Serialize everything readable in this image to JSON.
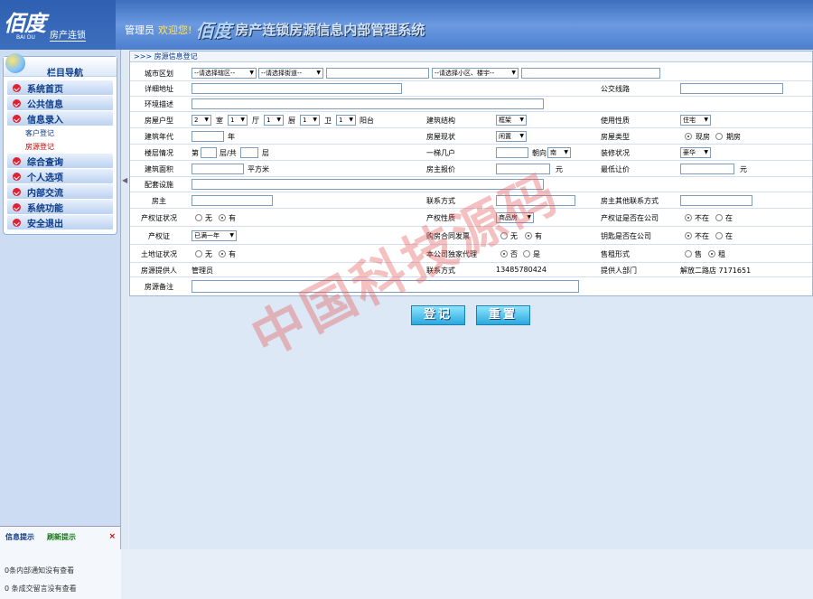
{
  "header": {
    "logo_main": "佰度",
    "logo_sub": "BAI DU",
    "logo_tag": "房产连锁",
    "user": "管理员",
    "welcome": "欢迎您!",
    "brand": "佰度",
    "title": "房产连锁房源信息内部管理系统"
  },
  "sidebar": {
    "title": "栏目导航",
    "items": [
      "系统首页",
      "公共信息",
      "信息录入",
      "综合查询",
      "个人选项",
      "内部交流",
      "系统功能",
      "安全退出"
    ],
    "subitems": [
      "客户登记",
      "房源登记"
    ]
  },
  "tips": {
    "tab_info": "信息提示",
    "tab_refresh": "刷新提示",
    "close": "×",
    "line1": "0条内部通知没有查看",
    "line2": "0 条成交留言没有查看"
  },
  "form": {
    "heading": ">>> 房源信息登记",
    "labels": {
      "city_district": "城市区划",
      "address": "详细地址",
      "bus_route": "公交线路",
      "environment": "环境描述",
      "house_type": "房屋户型",
      "room": "室",
      "hall": "厅",
      "kitchen": "厨",
      "bath": "卫",
      "balcony": "阳台",
      "structure": "建筑结构",
      "usage": "使用性质",
      "build_year": "建筑年代",
      "year_unit": "年",
      "condition": "房屋现状",
      "house_category": "房屋类型",
      "floor": "楼层情况",
      "floor_prefix": "第",
      "floor_mid": "层/共",
      "floor_suffix": "层",
      "households": "一梯几户",
      "orientation": "朝向",
      "decoration": "装修状况",
      "area": "建筑面积",
      "area_unit": "平方米",
      "owner_price": "房主报价",
      "price_unit": "元",
      "min_price": "最低让价",
      "min_unit": "元",
      "facilities": "配套设施",
      "owner": "房主",
      "contact": "联系方式",
      "owner_other_contact": "房主其他联系方式",
      "title_deed": "产权证状况",
      "property_nature": "产权性质",
      "deed_in_company": "产权证是否在公司",
      "deed": "产权证",
      "purchase_invoice": "购房合同发票",
      "keys_in_company": "钥匙是否在公司",
      "land_cert": "土地证状况",
      "exclusive_agent": "本公司独家代理",
      "sale_mode": "售租形式",
      "provider": "房源提供人",
      "provider_contact": "联系方式",
      "provider_dept": "提供人部门",
      "remark": "房源备注"
    },
    "selects": {
      "district": "--请选择辖区--",
      "street": "--请选择街道--",
      "community": "--请选择小区、楼宇--",
      "rooms": "2",
      "halls": "1",
      "kitchens": "1",
      "baths": "1",
      "balconies": "1",
      "structure": "框架",
      "usage": "住宅",
      "condition": "闲置",
      "orientation": "南",
      "decoration": "豪华",
      "property_nature": "商品房",
      "deed": "已满一年"
    },
    "radios": {
      "house_category": [
        "现房",
        "期房"
      ],
      "title_deed": [
        "无",
        "有"
      ],
      "deed_in_company": [
        "不在",
        "在"
      ],
      "purchase_invoice": [
        "无",
        "有"
      ],
      "keys_in_company": [
        "不在",
        "在"
      ],
      "land_cert": [
        "无",
        "有"
      ],
      "exclusive_agent": [
        "否",
        "是"
      ],
      "sale_mode": [
        "售",
        "租"
      ]
    },
    "values": {
      "provider": "管理员",
      "provider_contact": "13485780424",
      "provider_dept": "解放二路店 7171651"
    },
    "buttons": {
      "submit": "登记",
      "reset": "重置"
    }
  },
  "watermark": "中国科技源码"
}
